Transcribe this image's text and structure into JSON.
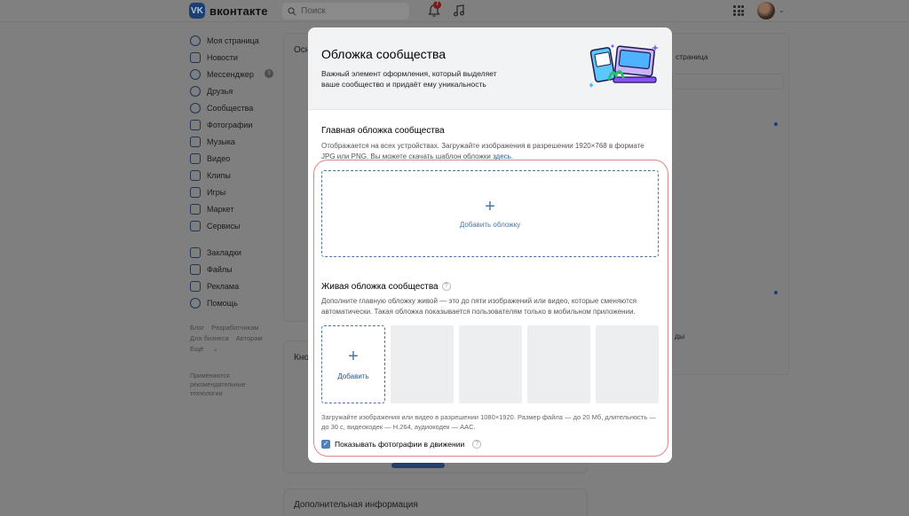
{
  "header": {
    "logo_text": "вконтакте",
    "logo_badge": "VK",
    "search_placeholder": "Поиск",
    "notifications_count": "7"
  },
  "sidebar": {
    "items": [
      {
        "label": "Моя страница",
        "icon": "user-icon"
      },
      {
        "label": "Новости",
        "icon": "news-icon"
      },
      {
        "label": "Мессенджер",
        "icon": "message-icon",
        "badge": "9"
      },
      {
        "label": "Друзья",
        "icon": "friends-icon"
      },
      {
        "label": "Сообщества",
        "icon": "communities-icon"
      },
      {
        "label": "Фотографии",
        "icon": "photo-icon"
      },
      {
        "label": "Музыка",
        "icon": "music-icon"
      },
      {
        "label": "Видео",
        "icon": "video-icon"
      },
      {
        "label": "Клипы",
        "icon": "clips-icon"
      },
      {
        "label": "Игры",
        "icon": "games-icon"
      },
      {
        "label": "Маркет",
        "icon": "market-icon"
      },
      {
        "label": "Сервисы",
        "icon": "services-icon"
      }
    ],
    "items2": [
      {
        "label": "Закладки",
        "icon": "bookmark-icon"
      },
      {
        "label": "Файлы",
        "icon": "file-icon"
      },
      {
        "label": "Реклама",
        "icon": "ads-icon"
      },
      {
        "label": "Помощь",
        "icon": "help-icon"
      }
    ],
    "footer_links": [
      "Блог",
      "Разработчикам",
      "Для бизнеса",
      "Авторам",
      "Ещё"
    ],
    "note": "Применяются рекомендательные технологии"
  },
  "background": {
    "card1_title": "Осн",
    "card2_title": "Кно",
    "card3_title": "Дополнительная информация",
    "right_title": "страница",
    "right_text": "ды"
  },
  "modal": {
    "title": "Обложка сообщества",
    "description": "Важный элемент оформления, который выделяет ваше сообщество и придаёт ему уникальность",
    "main_cover": {
      "title": "Главная обложка сообщества",
      "description_prefix": "Отображается на всех устройствах. Загружайте изображения в разрешении 1920×768 в формате JPG или PNG. Вы можете скачать шаблон обложки ",
      "link_text": "здесь",
      "description_suffix": ".",
      "add_label": "Добавить обложку"
    },
    "live_cover": {
      "title": "Живая обложка сообщества",
      "help": "?",
      "description": "Дополните главную обложку живой — это до пяти изображений или видео, которые сменяются автоматически. Такая обложка показывается пользователям только в мобильном приложении.",
      "add_label": "Добавить",
      "empty_slots": 4,
      "hint": "Загружайте изображения или видео в разрешении 1080×1920. Размер файла — до 20 Мб, длительность — до 30 с, видеокодек — H.264, аудиокодек — AAC.",
      "checkbox_label": "Показывать фотографии в движении",
      "checkbox_checked": true
    }
  },
  "colors": {
    "accent": "#4a76a8",
    "link": "#2a5885",
    "highlight": "#e4848c",
    "overlay": "#7f7f7f"
  }
}
